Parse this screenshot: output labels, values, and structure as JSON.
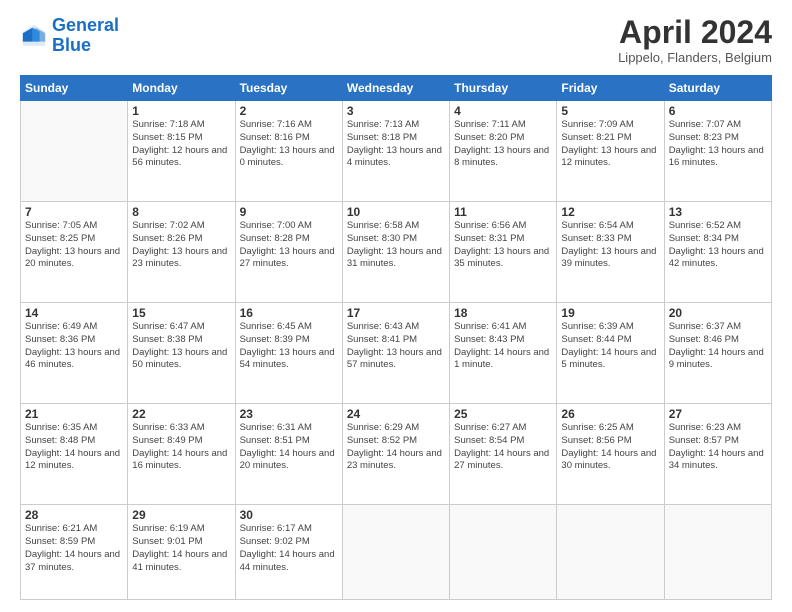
{
  "header": {
    "logo_line1": "General",
    "logo_line2": "Blue",
    "title": "April 2024",
    "location": "Lippelo, Flanders, Belgium"
  },
  "weekdays": [
    "Sunday",
    "Monday",
    "Tuesday",
    "Wednesday",
    "Thursday",
    "Friday",
    "Saturday"
  ],
  "weeks": [
    [
      {
        "day": "",
        "sunrise": "",
        "sunset": "",
        "daylight": ""
      },
      {
        "day": "1",
        "sunrise": "Sunrise: 7:18 AM",
        "sunset": "Sunset: 8:15 PM",
        "daylight": "Daylight: 12 hours and 56 minutes."
      },
      {
        "day": "2",
        "sunrise": "Sunrise: 7:16 AM",
        "sunset": "Sunset: 8:16 PM",
        "daylight": "Daylight: 13 hours and 0 minutes."
      },
      {
        "day": "3",
        "sunrise": "Sunrise: 7:13 AM",
        "sunset": "Sunset: 8:18 PM",
        "daylight": "Daylight: 13 hours and 4 minutes."
      },
      {
        "day": "4",
        "sunrise": "Sunrise: 7:11 AM",
        "sunset": "Sunset: 8:20 PM",
        "daylight": "Daylight: 13 hours and 8 minutes."
      },
      {
        "day": "5",
        "sunrise": "Sunrise: 7:09 AM",
        "sunset": "Sunset: 8:21 PM",
        "daylight": "Daylight: 13 hours and 12 minutes."
      },
      {
        "day": "6",
        "sunrise": "Sunrise: 7:07 AM",
        "sunset": "Sunset: 8:23 PM",
        "daylight": "Daylight: 13 hours and 16 minutes."
      }
    ],
    [
      {
        "day": "7",
        "sunrise": "Sunrise: 7:05 AM",
        "sunset": "Sunset: 8:25 PM",
        "daylight": "Daylight: 13 hours and 20 minutes."
      },
      {
        "day": "8",
        "sunrise": "Sunrise: 7:02 AM",
        "sunset": "Sunset: 8:26 PM",
        "daylight": "Daylight: 13 hours and 23 minutes."
      },
      {
        "day": "9",
        "sunrise": "Sunrise: 7:00 AM",
        "sunset": "Sunset: 8:28 PM",
        "daylight": "Daylight: 13 hours and 27 minutes."
      },
      {
        "day": "10",
        "sunrise": "Sunrise: 6:58 AM",
        "sunset": "Sunset: 8:30 PM",
        "daylight": "Daylight: 13 hours and 31 minutes."
      },
      {
        "day": "11",
        "sunrise": "Sunrise: 6:56 AM",
        "sunset": "Sunset: 8:31 PM",
        "daylight": "Daylight: 13 hours and 35 minutes."
      },
      {
        "day": "12",
        "sunrise": "Sunrise: 6:54 AM",
        "sunset": "Sunset: 8:33 PM",
        "daylight": "Daylight: 13 hours and 39 minutes."
      },
      {
        "day": "13",
        "sunrise": "Sunrise: 6:52 AM",
        "sunset": "Sunset: 8:34 PM",
        "daylight": "Daylight: 13 hours and 42 minutes."
      }
    ],
    [
      {
        "day": "14",
        "sunrise": "Sunrise: 6:49 AM",
        "sunset": "Sunset: 8:36 PM",
        "daylight": "Daylight: 13 hours and 46 minutes."
      },
      {
        "day": "15",
        "sunrise": "Sunrise: 6:47 AM",
        "sunset": "Sunset: 8:38 PM",
        "daylight": "Daylight: 13 hours and 50 minutes."
      },
      {
        "day": "16",
        "sunrise": "Sunrise: 6:45 AM",
        "sunset": "Sunset: 8:39 PM",
        "daylight": "Daylight: 13 hours and 54 minutes."
      },
      {
        "day": "17",
        "sunrise": "Sunrise: 6:43 AM",
        "sunset": "Sunset: 8:41 PM",
        "daylight": "Daylight: 13 hours and 57 minutes."
      },
      {
        "day": "18",
        "sunrise": "Sunrise: 6:41 AM",
        "sunset": "Sunset: 8:43 PM",
        "daylight": "Daylight: 14 hours and 1 minute."
      },
      {
        "day": "19",
        "sunrise": "Sunrise: 6:39 AM",
        "sunset": "Sunset: 8:44 PM",
        "daylight": "Daylight: 14 hours and 5 minutes."
      },
      {
        "day": "20",
        "sunrise": "Sunrise: 6:37 AM",
        "sunset": "Sunset: 8:46 PM",
        "daylight": "Daylight: 14 hours and 9 minutes."
      }
    ],
    [
      {
        "day": "21",
        "sunrise": "Sunrise: 6:35 AM",
        "sunset": "Sunset: 8:48 PM",
        "daylight": "Daylight: 14 hours and 12 minutes."
      },
      {
        "day": "22",
        "sunrise": "Sunrise: 6:33 AM",
        "sunset": "Sunset: 8:49 PM",
        "daylight": "Daylight: 14 hours and 16 minutes."
      },
      {
        "day": "23",
        "sunrise": "Sunrise: 6:31 AM",
        "sunset": "Sunset: 8:51 PM",
        "daylight": "Daylight: 14 hours and 20 minutes."
      },
      {
        "day": "24",
        "sunrise": "Sunrise: 6:29 AM",
        "sunset": "Sunset: 8:52 PM",
        "daylight": "Daylight: 14 hours and 23 minutes."
      },
      {
        "day": "25",
        "sunrise": "Sunrise: 6:27 AM",
        "sunset": "Sunset: 8:54 PM",
        "daylight": "Daylight: 14 hours and 27 minutes."
      },
      {
        "day": "26",
        "sunrise": "Sunrise: 6:25 AM",
        "sunset": "Sunset: 8:56 PM",
        "daylight": "Daylight: 14 hours and 30 minutes."
      },
      {
        "day": "27",
        "sunrise": "Sunrise: 6:23 AM",
        "sunset": "Sunset: 8:57 PM",
        "daylight": "Daylight: 14 hours and 34 minutes."
      }
    ],
    [
      {
        "day": "28",
        "sunrise": "Sunrise: 6:21 AM",
        "sunset": "Sunset: 8:59 PM",
        "daylight": "Daylight: 14 hours and 37 minutes."
      },
      {
        "day": "29",
        "sunrise": "Sunrise: 6:19 AM",
        "sunset": "Sunset: 9:01 PM",
        "daylight": "Daylight: 14 hours and 41 minutes."
      },
      {
        "day": "30",
        "sunrise": "Sunrise: 6:17 AM",
        "sunset": "Sunset: 9:02 PM",
        "daylight": "Daylight: 14 hours and 44 minutes."
      },
      {
        "day": "",
        "sunrise": "",
        "sunset": "",
        "daylight": ""
      },
      {
        "day": "",
        "sunrise": "",
        "sunset": "",
        "daylight": ""
      },
      {
        "day": "",
        "sunrise": "",
        "sunset": "",
        "daylight": ""
      },
      {
        "day": "",
        "sunrise": "",
        "sunset": "",
        "daylight": ""
      }
    ]
  ]
}
